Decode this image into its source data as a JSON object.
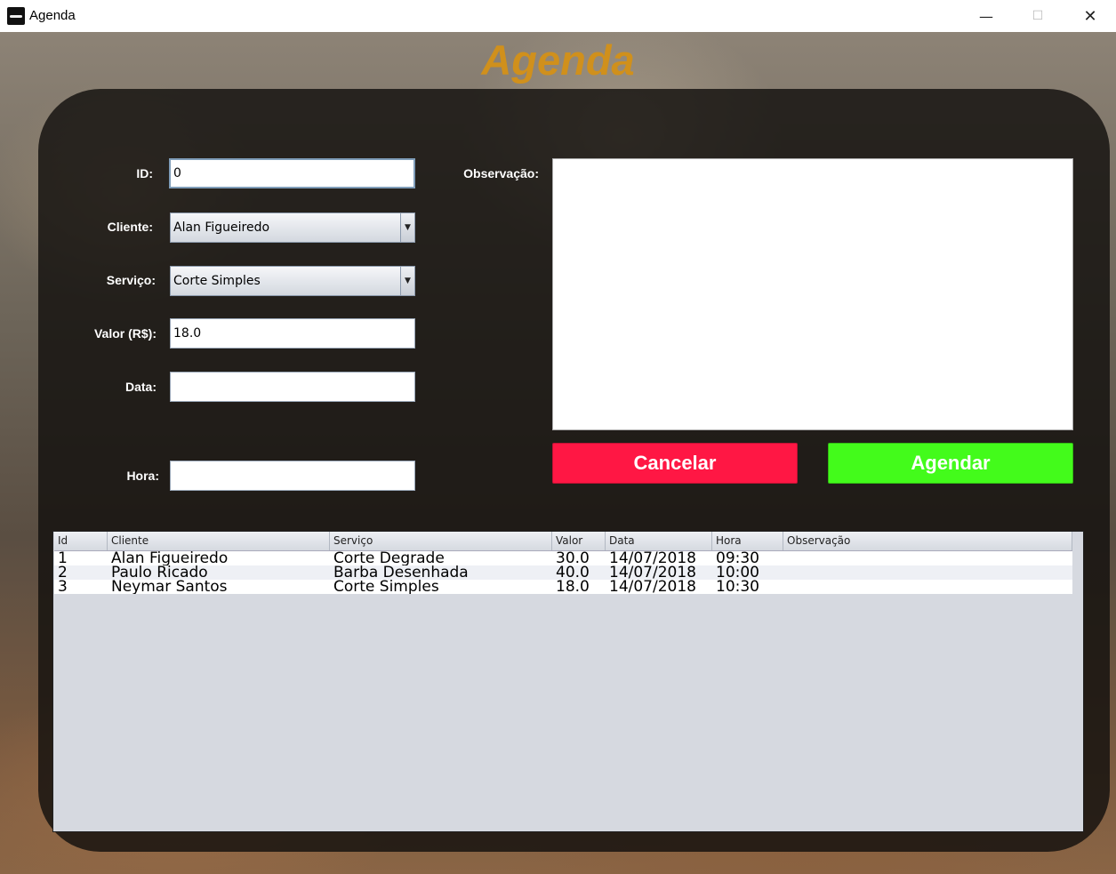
{
  "window": {
    "title": "Agenda",
    "minimize": "—",
    "maximize": "☐",
    "close": "✕"
  },
  "heading": "Agenda",
  "form": {
    "id_label": "ID:",
    "id_value": "0",
    "cliente_label": "Cliente:",
    "cliente_value": "Alan Figueiredo",
    "servico_label": "Serviço:",
    "servico_value": "Corte Simples",
    "valor_label": "Valor (R$):",
    "valor_value": "18.0",
    "data_label": "Data:",
    "data_value": "",
    "hora_label": "Hora:",
    "hora_value": "",
    "obs_label": "Observação:",
    "obs_value": ""
  },
  "buttons": {
    "cancel": "Cancelar",
    "book": "Agendar"
  },
  "table": {
    "columns": [
      "Id",
      "Cliente",
      "Serviço",
      "Valor",
      "Data",
      "Hora",
      "Observação"
    ],
    "rows": [
      [
        "1",
        "Alan Figueiredo",
        "Corte Degrade",
        "30.0",
        "14/07/2018",
        "09:30",
        ""
      ],
      [
        "2",
        "Paulo Ricado",
        "Barba Desenhada",
        "40.0",
        "14/07/2018",
        "10:00",
        ""
      ],
      [
        "3",
        "Neymar Santos",
        "Corte Simples",
        "18.0",
        "14/07/2018",
        "10:30",
        ""
      ]
    ]
  },
  "colors": {
    "heading": "#d0901c",
    "cancel": "#ff1744",
    "book": "#43fb1b"
  }
}
